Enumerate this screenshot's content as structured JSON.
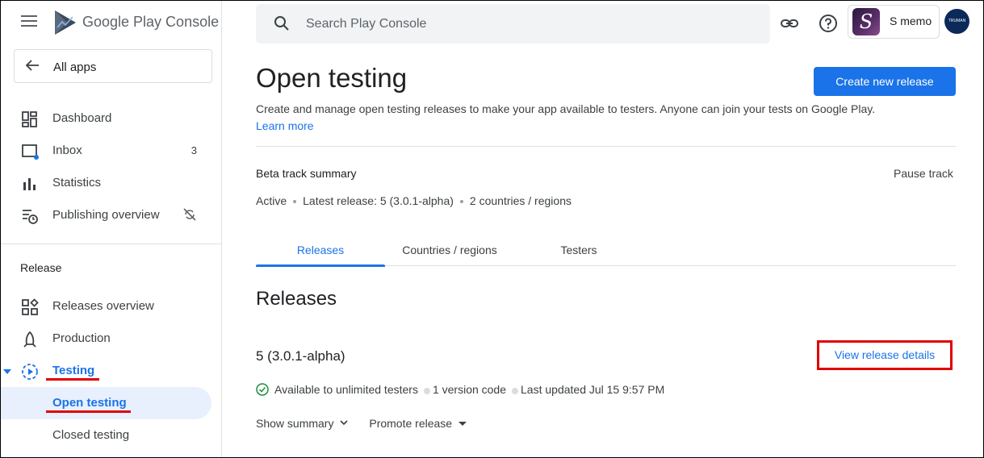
{
  "brand": {
    "name": "Google Play Console"
  },
  "sidebar": {
    "all_apps": "All apps",
    "items": [
      {
        "label": "Dashboard",
        "icon": "dashboard-icon"
      },
      {
        "label": "Inbox",
        "icon": "inbox-icon",
        "count": "3"
      },
      {
        "label": "Statistics",
        "icon": "bar-chart-icon"
      },
      {
        "label": "Publishing overview",
        "icon": "publishing-overview-icon"
      }
    ],
    "section_release": "Release",
    "release_items": [
      {
        "label": "Releases overview",
        "icon": "releases-overview-icon"
      },
      {
        "label": "Production",
        "icon": "production-icon"
      },
      {
        "label": "Testing",
        "icon": "testing-icon"
      },
      {
        "label": "Open testing"
      },
      {
        "label": "Closed testing"
      }
    ]
  },
  "topbar": {
    "search_placeholder": "Search Play Console",
    "account_name": "S memo",
    "app_initial": "S",
    "avatar_text": "TRUMAN"
  },
  "page": {
    "title": "Open testing",
    "create_button": "Create new release",
    "description": "Create and manage open testing releases to make your app available to testers. Anyone can join your tests on Google Play.",
    "learn_more": "Learn more",
    "track_summary_title": "Beta track summary",
    "pause_track": "Pause track",
    "track_status": "Active",
    "track_latest": "Latest release: 5 (3.0.1-alpha)",
    "track_countries": "2 countries / regions",
    "tabs": [
      "Releases",
      "Countries / regions",
      "Testers"
    ],
    "releases_heading": "Releases",
    "release": {
      "name": "5 (3.0.1-alpha)",
      "view_details": "View release details",
      "availability": "Available to unlimited testers",
      "version_codes": "1 version code",
      "last_updated": "Last updated Jul 15 9:57 PM",
      "show_summary": "Show summary",
      "promote": "Promote release"
    }
  },
  "colors": {
    "accent": "#1a73e8",
    "highlight": "#e00000",
    "active_bg": "#e8f0fe"
  }
}
